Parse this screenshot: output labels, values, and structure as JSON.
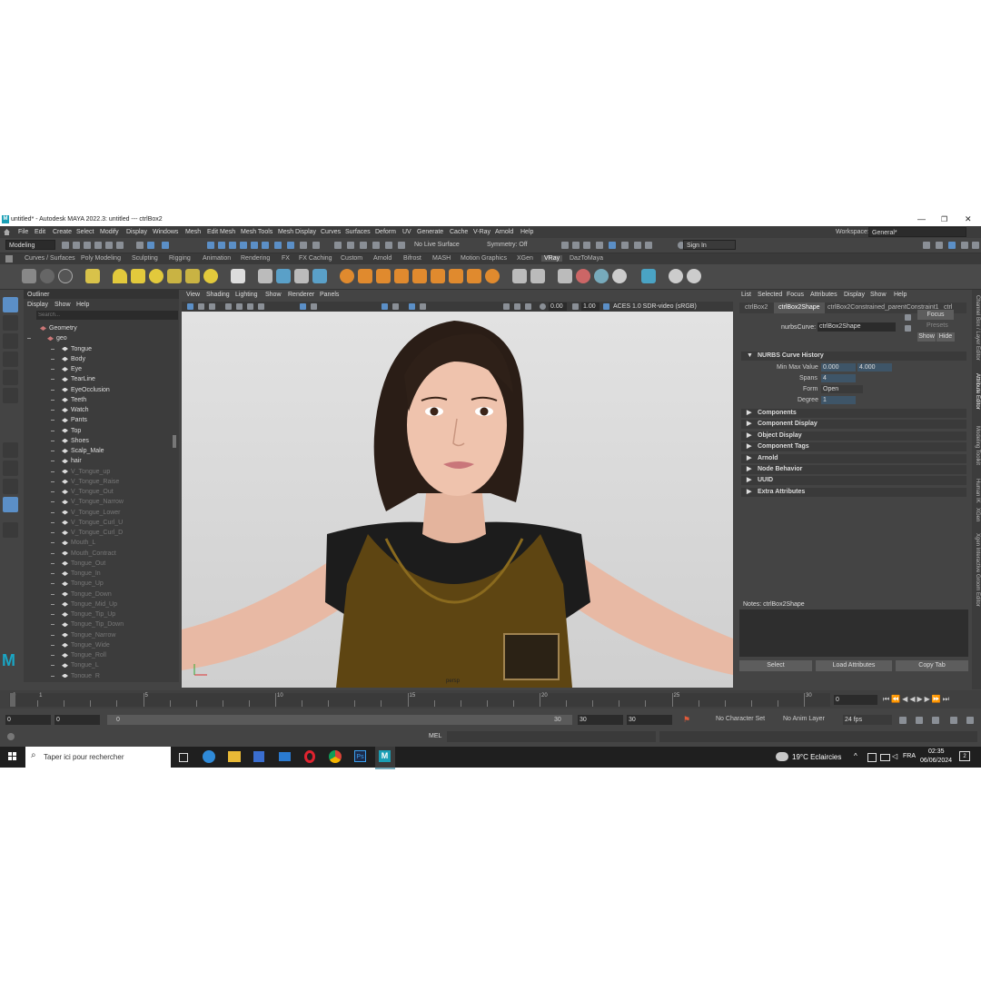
{
  "titlebar": {
    "title": "untitled* - Autodesk MAYA 2022.3: untitled   ---   ctrlBox2",
    "logo": "M",
    "min": "—",
    "max": "❐",
    "close": "✕"
  },
  "menubar": {
    "items": [
      "File",
      "Edit",
      "Create",
      "Select",
      "Modify",
      "Display",
      "Windows",
      "Mesh",
      "Edit Mesh",
      "Mesh Tools",
      "Mesh Display",
      "Curves",
      "Surfaces",
      "Deform",
      "UV",
      "Generate",
      "Cache",
      "V-Ray",
      "Arnold",
      "Help"
    ],
    "workspace_label": "Workspace:",
    "workspace_value": "General*"
  },
  "statusline": {
    "mode": "Modeling",
    "live_surface": "No Live Surface",
    "symmetry": "Symmetry: Off",
    "sign_in": "Sign In"
  },
  "shelf_tabs": [
    "Curves / Surfaces",
    "Poly Modeling",
    "Sculpting",
    "Rigging",
    "Animation",
    "Rendering",
    "FX",
    "FX Caching",
    "Custom",
    "Arnold",
    "Bifrost",
    "MASH",
    "Motion Graphics",
    "XGen",
    "VRay",
    "DazToMaya"
  ],
  "shelf_active": "VRay",
  "outliner": {
    "title": "Outliner",
    "menu": [
      "Display",
      "Show",
      "Help"
    ],
    "search_placeholder": "Search...",
    "items": [
      {
        "label": "Geometry",
        "depth": 0,
        "dim": false
      },
      {
        "label": "geo",
        "depth": 1,
        "dim": false
      },
      {
        "label": "Tongue",
        "depth": 2,
        "dim": false
      },
      {
        "label": "Body",
        "depth": 2,
        "dim": false
      },
      {
        "label": "Eye",
        "depth": 2,
        "dim": false
      },
      {
        "label": "TearLine",
        "depth": 2,
        "dim": false
      },
      {
        "label": "EyeOcclusion",
        "depth": 2,
        "dim": false
      },
      {
        "label": "Teeth",
        "depth": 2,
        "dim": false
      },
      {
        "label": "Watch",
        "depth": 2,
        "dim": false
      },
      {
        "label": "Pants",
        "depth": 2,
        "dim": false
      },
      {
        "label": "Top",
        "depth": 2,
        "dim": false
      },
      {
        "label": "Shoes",
        "depth": 2,
        "dim": false
      },
      {
        "label": "Scalp_Male",
        "depth": 2,
        "dim": false
      },
      {
        "label": "hair",
        "depth": 2,
        "dim": false
      },
      {
        "label": "V_Tongue_up",
        "depth": 2,
        "dim": true
      },
      {
        "label": "V_Tongue_Raise",
        "depth": 2,
        "dim": true
      },
      {
        "label": "V_Tongue_Out",
        "depth": 2,
        "dim": true
      },
      {
        "label": "V_Tongue_Narrow",
        "depth": 2,
        "dim": true
      },
      {
        "label": "V_Tongue_Lower",
        "depth": 2,
        "dim": true
      },
      {
        "label": "V_Tongue_Curl_U",
        "depth": 2,
        "dim": true
      },
      {
        "label": "V_Tongue_Curl_D",
        "depth": 2,
        "dim": true
      },
      {
        "label": "Mouth_L",
        "depth": 2,
        "dim": true
      },
      {
        "label": "Mouth_Contract",
        "depth": 2,
        "dim": true
      },
      {
        "label": "Tongue_Out",
        "depth": 2,
        "dim": true
      },
      {
        "label": "Tongue_In",
        "depth": 2,
        "dim": true
      },
      {
        "label": "Tongue_Up",
        "depth": 2,
        "dim": true
      },
      {
        "label": "Tongue_Down",
        "depth": 2,
        "dim": true
      },
      {
        "label": "Tongue_Mid_Up",
        "depth": 2,
        "dim": true
      },
      {
        "label": "Tongue_Tip_Up",
        "depth": 2,
        "dim": true
      },
      {
        "label": "Tongue_Tip_Down",
        "depth": 2,
        "dim": true
      },
      {
        "label": "Tongue_Narrow",
        "depth": 2,
        "dim": true
      },
      {
        "label": "Tongue_Wide",
        "depth": 2,
        "dim": true
      },
      {
        "label": "Tongue_Roll",
        "depth": 2,
        "dim": true
      },
      {
        "label": "Tongue_L",
        "depth": 2,
        "dim": true
      },
      {
        "label": "Tongue_R",
        "depth": 2,
        "dim": true
      }
    ]
  },
  "viewport": {
    "menu": [
      "View",
      "Shading",
      "Lighting",
      "Show",
      "Renderer",
      "Panels"
    ],
    "exposure": "0.00",
    "gamma": "1.00",
    "colorspace": "ACES 1.0 SDR-video (sRGB)",
    "camera": "persp"
  },
  "attribute_editor": {
    "menu": [
      "List",
      "Selected",
      "Focus",
      "Attributes",
      "Display",
      "Show",
      "Help"
    ],
    "tabs": [
      "ctrlBox2",
      "ctrlBox2Shape",
      "ctrlBox2Constrained_parentConstraint1",
      "ctrl"
    ],
    "active_tab": "ctrlBox2Shape",
    "node_type_label": "nurbsCurve:",
    "node_name": "ctrlBox2Shape",
    "focus": "Focus",
    "presets": "Presets",
    "show": "Show",
    "hide": "Hide",
    "history_title": "NURBS Curve History",
    "min_max_label": "Min Max Value",
    "min_value": "0.000",
    "max_value": "4.000",
    "spans_label": "Spans",
    "spans": "4",
    "form_label": "Form",
    "form": "Open",
    "degree_label": "Degree",
    "degree": "1",
    "sections": [
      "Components",
      "Component Display",
      "Object Display",
      "Component Tags",
      "Arnold",
      "Node Behavior",
      "UUID",
      "Extra Attributes"
    ],
    "notes_label": "Notes: ctrlBox2Shape",
    "bottom_buttons": [
      "Select",
      "Load Attributes",
      "Copy Tab"
    ]
  },
  "side_tabs": [
    "Channel Box / Layer Editor",
    "Attribute Editor",
    "Modeling Toolkit",
    "Human IK",
    "XGen",
    "Xgen Interactive Groom Editor"
  ],
  "timeline": {
    "ticks": [
      "0",
      "1",
      "5",
      "10",
      "15",
      "20",
      "25",
      "30"
    ],
    "current_frame": "0"
  },
  "range": {
    "start": "0",
    "start2": "0",
    "slider_start": "0",
    "slider_end": "30",
    "end": "30",
    "end2": "30",
    "character_set": "No Character Set",
    "anim_layer": "No Anim Layer",
    "fps": "24 fps"
  },
  "command": {
    "lang": "MEL"
  },
  "taskbar": {
    "search_placeholder": "Taper ici pour rechercher",
    "weather": "19°C  Eclaircies",
    "lang": "FRA",
    "time": "02:35",
    "date": "06/06/2024",
    "notifications": "2"
  }
}
